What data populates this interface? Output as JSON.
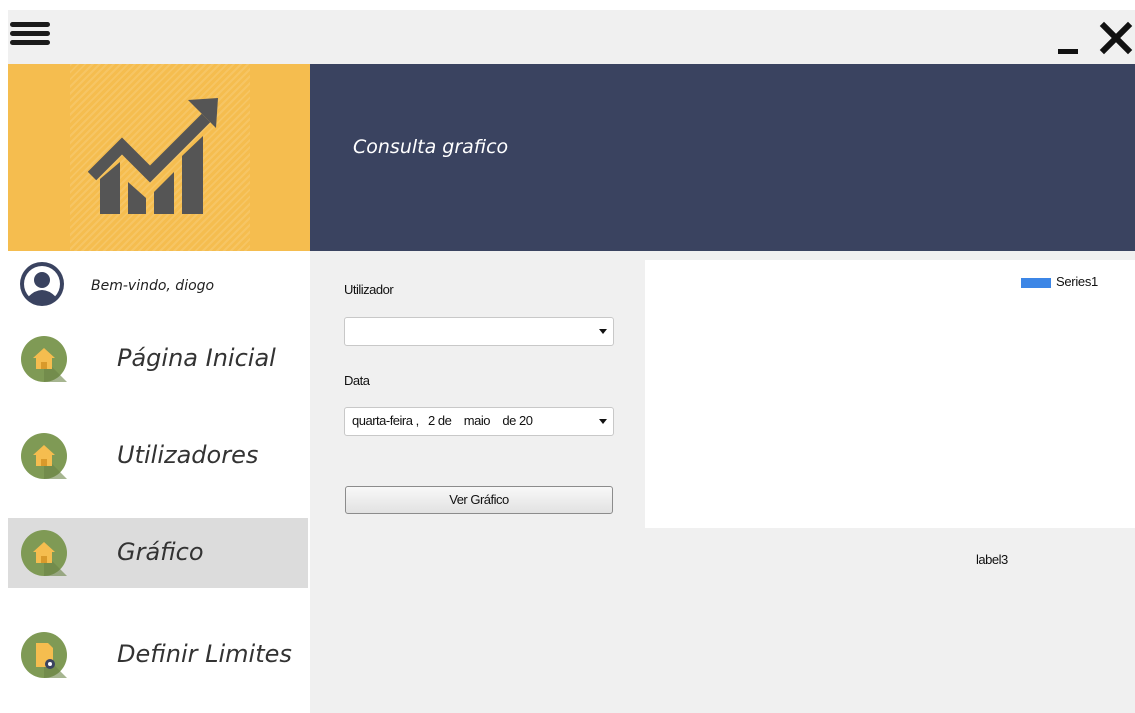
{
  "window": {
    "menu_icon": "hamburger-menu-icon",
    "minimize_icon": "minimize-icon",
    "close_icon": "close-icon"
  },
  "header": {
    "title": "Consulta grafico"
  },
  "logo": {
    "icon": "chart-growth-icon",
    "accent": "#f5bd4f"
  },
  "sidebar": {
    "welcome": "Bem-vindo, diogo",
    "user_icon": "user-avatar-icon",
    "items": [
      {
        "label": "Página Inicial",
        "icon": "home-icon",
        "active": false
      },
      {
        "label": "Utilizadores",
        "icon": "home-icon",
        "active": false
      },
      {
        "label": "Gráfico",
        "icon": "home-icon",
        "active": true
      },
      {
        "label": "Definir Limites",
        "icon": "document-settings-icon",
        "active": false
      }
    ]
  },
  "form": {
    "user_label": "Utilizador",
    "user_value": "",
    "date_label": "Data",
    "date_value": "quarta-feira ,   2 de    maio    de 20",
    "button_label": "Ver Gráfico"
  },
  "chart_data": {
    "type": "bar",
    "series": [
      {
        "name": "Series1",
        "values": []
      }
    ],
    "legend": "top-right"
  },
  "status_label": "label3",
  "colors": {
    "header_bg": "#3a4360",
    "logo_bg": "#f5bd4f",
    "nav_icon_circle": "#7f9a55",
    "active_nav_bg": "#dcdcdc",
    "series_color": "#3c86e6"
  }
}
